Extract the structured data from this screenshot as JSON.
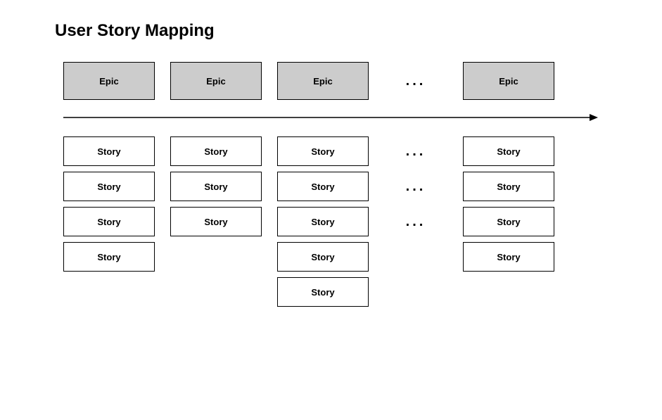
{
  "title": "User Story Mapping",
  "ellipsis": "...",
  "epics": {
    "col1": "Epic",
    "col2": "Epic",
    "col3": "Epic",
    "col5": "Epic"
  },
  "stories": {
    "col1": [
      "Story",
      "Story",
      "Story",
      "Story"
    ],
    "col2": [
      "Story",
      "Story",
      "Story"
    ],
    "col3": [
      "Story",
      "Story",
      "Story",
      "Story",
      "Story"
    ],
    "col4_ellipsis": [
      "...",
      "...",
      "..."
    ],
    "col5": [
      "Story",
      "Story",
      "Story",
      "Story"
    ]
  }
}
